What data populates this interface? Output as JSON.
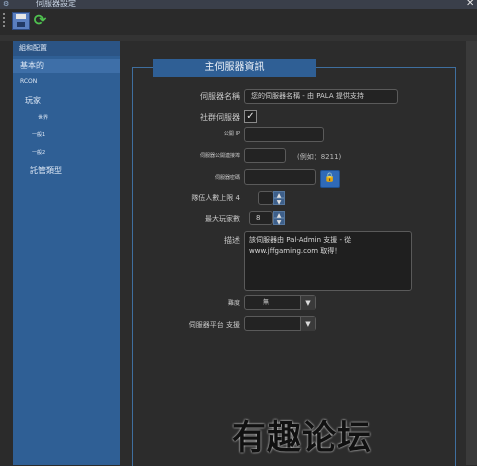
{
  "window": {
    "title": "伺服器設定",
    "close_glyph": "✕"
  },
  "toolbar": {
    "save_icon": "save-icon",
    "refresh_icon": "refresh-icon"
  },
  "sidebar": {
    "header": "組和配置",
    "items": [
      {
        "label": "基本的",
        "selected": true
      },
      {
        "label": "RCON"
      },
      {
        "label": "玩家"
      },
      {
        "label": "世界"
      },
      {
        "label": "一般1"
      },
      {
        "label": "一般2"
      },
      {
        "label": "託管類型"
      }
    ]
  },
  "main": {
    "group_title": "主伺服器資訊",
    "server_name_label": "伺服器名稱",
    "server_name_value": "您的伺服器名稱 - 由 PALA 提供支持",
    "community_label": "社群伺服器",
    "community_checked": true,
    "public_ip_label": "公開 IP",
    "public_ip_value": "",
    "public_port_label": "伺服器公開連接埠",
    "public_port_value": "",
    "public_port_hint": "(例如：8211)",
    "password_label": "伺服器密碼",
    "password_value": "",
    "party_max_label": "隊伍人數上限 4",
    "party_max_value": "",
    "max_players_label": "最大玩家數",
    "max_players_value": "8",
    "description_label": "描述",
    "description_value": "該伺服器由 Pal-Admin 支援 - 從 www.jffgaming.com 取得！",
    "difficulty_label": "難度",
    "difficulty_value": "無",
    "platform_label": "伺服器平台 支援",
    "platform_value": ""
  },
  "watermark": "有趣论坛",
  "colors": {
    "sidebar": "#2f5f95",
    "background": "#2b2b2b",
    "accent_border": "#3f6f9f"
  }
}
